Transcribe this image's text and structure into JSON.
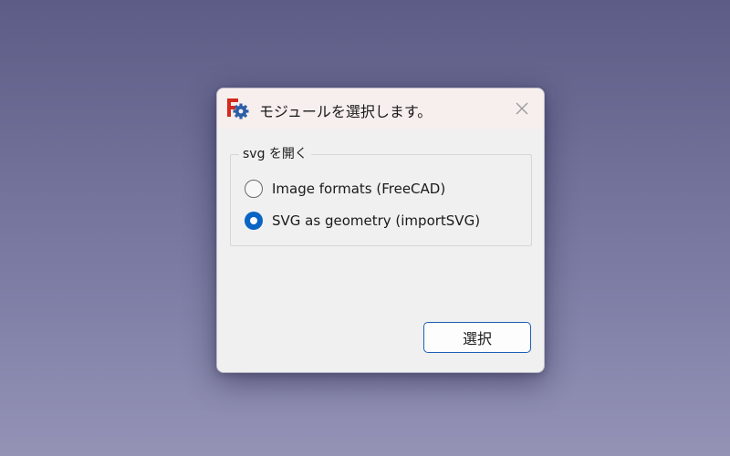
{
  "dialog": {
    "title": "モジュールを選択します。",
    "app_icon": "freecad-gear-icon",
    "close_icon": "close-icon"
  },
  "group": {
    "title": "svg を開く",
    "options": [
      {
        "label": "Image formats (FreeCAD)",
        "selected": false
      },
      {
        "label": "SVG as geometry (importSVG)",
        "selected": true
      }
    ]
  },
  "actions": {
    "select_label": "選択"
  },
  "colors": {
    "accent": "#0a64c4",
    "titlebar": "#f7efed",
    "dialog_bg": "#f0f0f0"
  }
}
